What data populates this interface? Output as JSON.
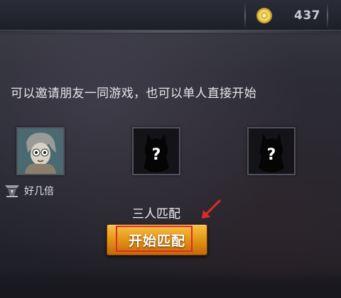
{
  "currency": {
    "value": "437",
    "icon": "gold-coin-icon"
  },
  "invite_text": "可以邀请朋友一同游戏，也可以单人直接开始",
  "slots": [
    {
      "state": "filled",
      "player_name": "好几倍",
      "rank_icon": "rank-badge-icon"
    },
    {
      "state": "empty",
      "icon": "unknown-player-icon"
    },
    {
      "state": "empty",
      "icon": "unknown-player-icon"
    }
  ],
  "mode_label": "三人匹配",
  "start_button": {
    "label": "开始匹配"
  },
  "annotation": {
    "color": "#e02a2a"
  },
  "colors": {
    "button_gold": "#e59a18",
    "background": "#262731"
  }
}
